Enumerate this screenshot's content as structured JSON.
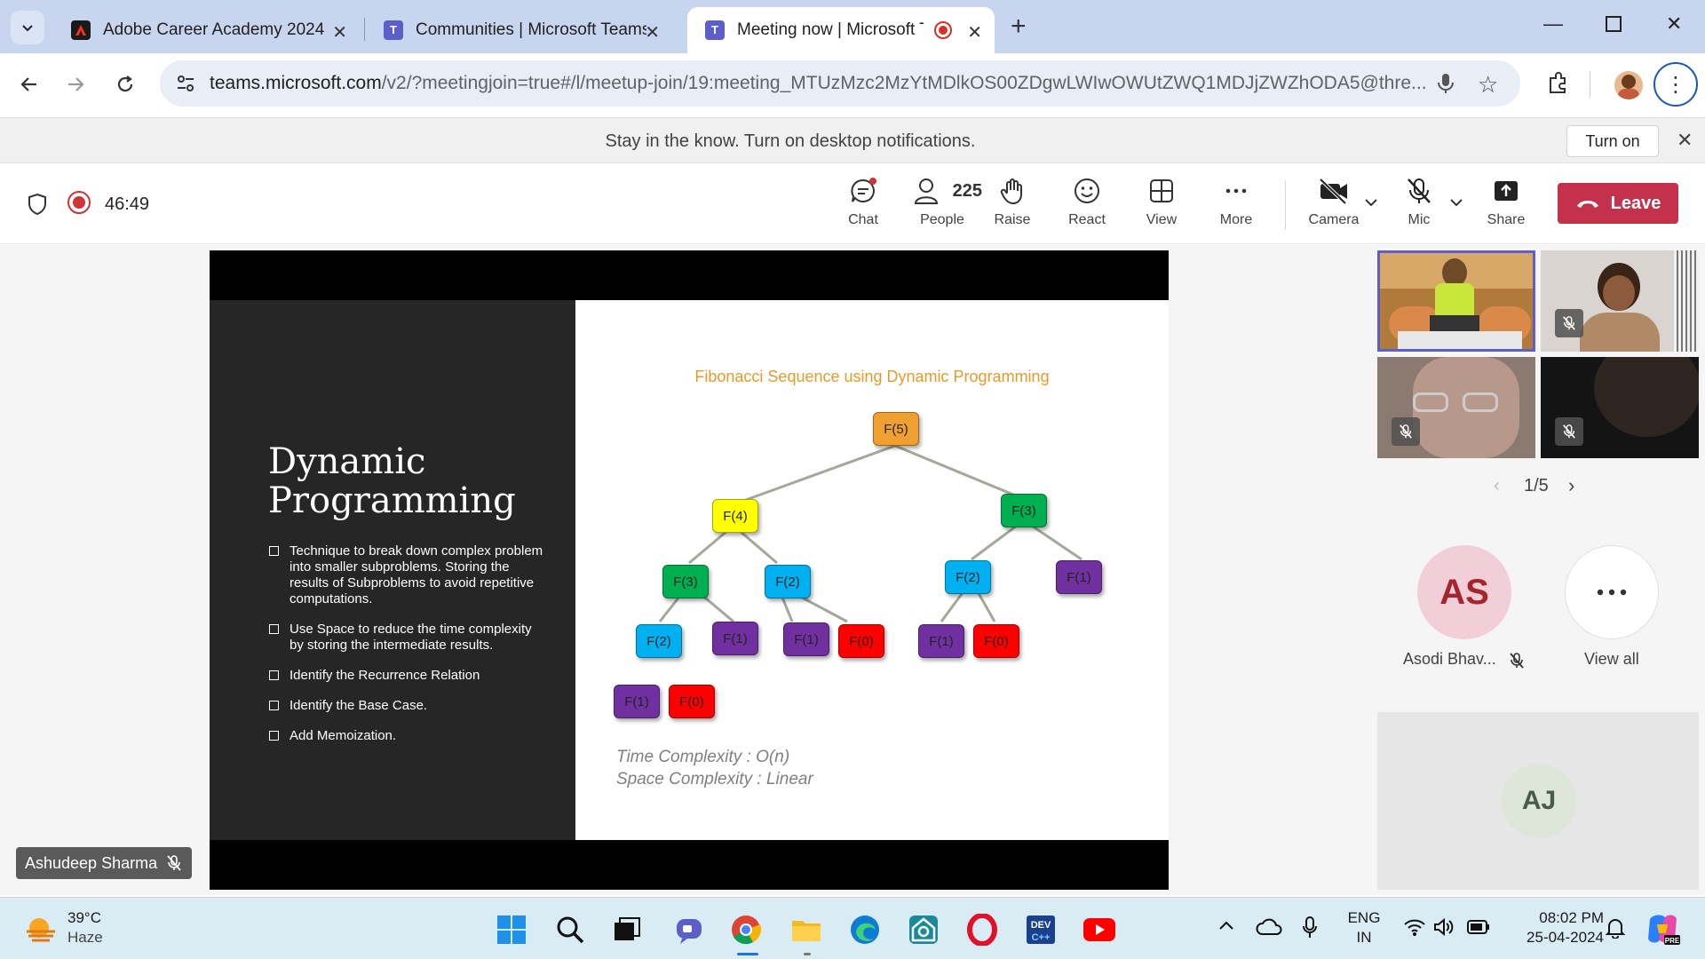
{
  "browser": {
    "tabs": [
      {
        "title": "Adobe Career Academy 2024"
      },
      {
        "title": "Communities | Microsoft Teams"
      },
      {
        "title": "Meeting now | Microsoft Teams"
      }
    ],
    "url_host": "teams.microsoft.com",
    "url_rest": "/v2/?meetingjoin=true#/l/meetup-join/19:meeting_MTUzMzc2MzYtMDlkOS00ZDgwLWIwOWUtZWQ1MDJjZWZhODA5@thre..."
  },
  "notification": {
    "message": "Stay in the know. Turn on desktop notifications.",
    "turn_on": "Turn on"
  },
  "toolbar": {
    "timer": "46:49",
    "chat": "Chat",
    "people": "People",
    "people_count": "225",
    "raise": "Raise",
    "react": "React",
    "view": "View",
    "more": "More",
    "camera": "Camera",
    "mic": "Mic",
    "share": "Share",
    "leave": "Leave"
  },
  "slide": {
    "title_line1": "Dynamic",
    "title_line2": "Programming",
    "bullets": [
      "Technique to break down complex problem into smaller subproblems. Storing the results of Subproblems to avoid repetitive computations.",
      "Use Space to reduce the time complexity by storing the intermediate results.",
      "Identify the Recurrence Relation",
      "Identify the Base Case.",
      "Add Memoization."
    ],
    "diagram_title": "Fibonacci Sequence using Dynamic Programming",
    "nodes": [
      "F(5)",
      "F(4)",
      "F(3)",
      "F(3)",
      "F(2)",
      "F(2)",
      "F(1)",
      "F(2)",
      "F(1)",
      "F(1)",
      "F(0)",
      "F(1)",
      "F(0)",
      "F(1)",
      "F(0)"
    ],
    "time_complexity": "Time Complexity : O(n)",
    "space_complexity": "Space Complexity : Linear"
  },
  "presenter": {
    "name": "Ashudeep Sharma"
  },
  "participants": {
    "pager": "1/5",
    "as_initials": "AS",
    "as_name": "Asodi Bhav...",
    "view_all": "View all",
    "aj_initials": "AJ"
  },
  "taskbar": {
    "temperature": "39°C",
    "weather": "Haze",
    "lang": "ENG",
    "region": "IN",
    "time": "08:02 PM",
    "date": "25-04-2024"
  },
  "colors": {
    "leave": "#c4314b",
    "orange": "#f0a030",
    "yellow": "#ffff00",
    "green": "#00b050",
    "blue": "#00b0f0",
    "purple": "#7030a0",
    "red": "#ff0000"
  }
}
